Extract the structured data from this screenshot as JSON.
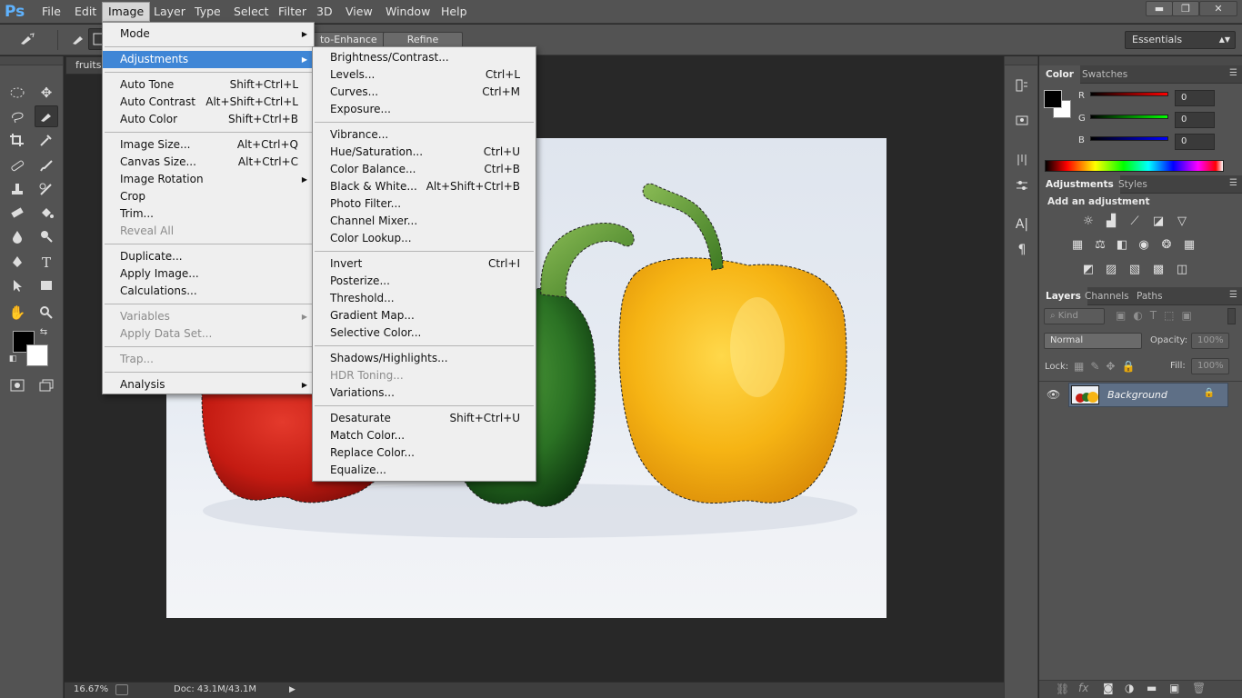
{
  "app": {
    "logo": "Ps"
  },
  "menubar": {
    "items": [
      "File",
      "Edit",
      "Image",
      "Layer",
      "Type",
      "Select",
      "Filter",
      "3D",
      "View",
      "Window",
      "Help"
    ],
    "active": "Image"
  },
  "window_controls": {
    "minimize": "▬",
    "restore": "❐",
    "close": "✕"
  },
  "options_bar": {
    "auto_enhance_label": "to-Enhance",
    "refine_edge_label": "Refine Edge...",
    "workspace": "Essentials"
  },
  "document": {
    "tab_title": "fruits",
    "zoom": "16.67%",
    "doc_info": "Doc: 43.1M/43.1M"
  },
  "image_menu": {
    "mode": "Mode",
    "adjustments": "Adjustments",
    "auto_tone": {
      "label": "Auto Tone",
      "shortcut": "Shift+Ctrl+L"
    },
    "auto_contrast": {
      "label": "Auto Contrast",
      "shortcut": "Alt+Shift+Ctrl+L"
    },
    "auto_color": {
      "label": "Auto Color",
      "shortcut": "Shift+Ctrl+B"
    },
    "image_size": {
      "label": "Image Size...",
      "shortcut": "Alt+Ctrl+Q"
    },
    "canvas_size": {
      "label": "Canvas Size...",
      "shortcut": "Alt+Ctrl+C"
    },
    "image_rotation": "Image Rotation",
    "crop": "Crop",
    "trim": "Trim...",
    "reveal_all": "Reveal All",
    "duplicate": "Duplicate...",
    "apply_image": "Apply Image...",
    "calculations": "Calculations...",
    "variables": "Variables",
    "apply_data_set": "Apply Data Set...",
    "trap": "Trap...",
    "analysis": "Analysis"
  },
  "adjustments_menu": {
    "brightness_contrast": "Brightness/Contrast...",
    "levels": {
      "label": "Levels...",
      "shortcut": "Ctrl+L"
    },
    "curves": {
      "label": "Curves...",
      "shortcut": "Ctrl+M"
    },
    "exposure": "Exposure...",
    "vibrance": "Vibrance...",
    "hue_saturation": {
      "label": "Hue/Saturation...",
      "shortcut": "Ctrl+U"
    },
    "color_balance": {
      "label": "Color Balance...",
      "shortcut": "Ctrl+B"
    },
    "black_white": {
      "label": "Black & White...",
      "shortcut": "Alt+Shift+Ctrl+B"
    },
    "photo_filter": "Photo Filter...",
    "channel_mixer": "Channel Mixer...",
    "color_lookup": "Color Lookup...",
    "invert": {
      "label": "Invert",
      "shortcut": "Ctrl+I"
    },
    "posterize": "Posterize...",
    "threshold": "Threshold...",
    "gradient_map": "Gradient Map...",
    "selective_color": "Selective Color...",
    "shadows_highlights": "Shadows/Highlights...",
    "hdr_toning": "HDR Toning...",
    "variations": "Variations...",
    "desaturate": {
      "label": "Desaturate",
      "shortcut": "Shift+Ctrl+U"
    },
    "match_color": "Match Color...",
    "replace_color": "Replace Color...",
    "equalize": "Equalize..."
  },
  "color_panel": {
    "tabs": [
      "Color",
      "Swatches"
    ],
    "r_label": "R",
    "g_label": "G",
    "b_label": "B",
    "r_value": "0",
    "g_value": "0",
    "b_value": "0",
    "colors": {
      "red": "#ff0000",
      "green": "#00cc00",
      "blue": "#0000ff"
    }
  },
  "adjustments_panel": {
    "tabs": [
      "Adjustments",
      "Styles"
    ],
    "heading": "Add an adjustment"
  },
  "layers_panel": {
    "tabs": [
      "Layers",
      "Channels",
      "Paths"
    ],
    "filter_kind": "Kind",
    "blend_mode": "Normal",
    "opacity_label": "Opacity:",
    "opacity_value": "100%",
    "lock_label": "Lock:",
    "fill_label": "Fill:",
    "fill_value": "100%",
    "layer_name": "Background"
  }
}
